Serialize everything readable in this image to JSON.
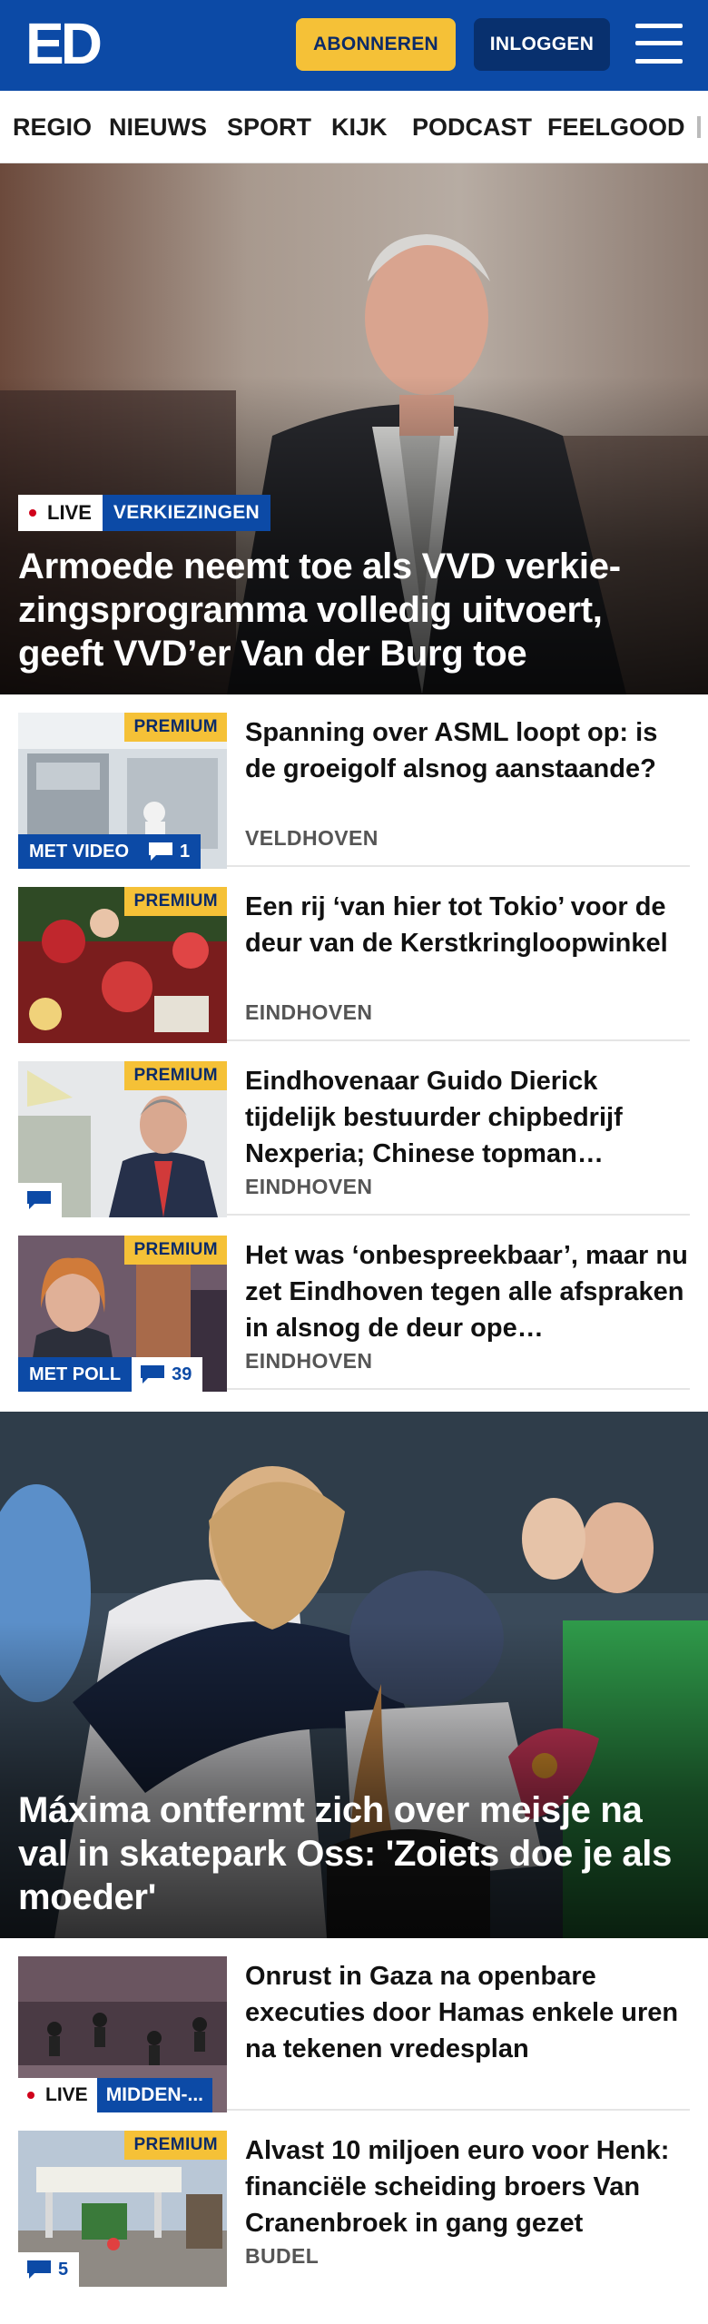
{
  "header": {
    "logo": "ED",
    "subscribe_label": "ABONNEREN",
    "login_label": "INLOGGEN",
    "brand_color": "#0c4aa6",
    "accent_color": "#f5c137"
  },
  "nav": {
    "items": [
      "REGIO",
      "NIEUWS",
      "SPORT",
      "KIJK",
      "PODCAST",
      "FEELGOOD"
    ]
  },
  "hero1": {
    "live_label": "LIVE",
    "tag": "VERKIEZINGEN",
    "title": "Armoede neemt toe als VVD verkie­zingsprogramma volledig uitvoert, geeft VVD’er Van der Burg toe"
  },
  "articles1": [
    {
      "premium": "PREMIUM",
      "media_tag": "MET VIDEO",
      "comments": "1",
      "headline": "Spanning over ASML loopt op: is de groeigolf alsnog aanstaande?",
      "location": "VELDHOVEN"
    },
    {
      "premium": "PREMIUM",
      "headline": "Een rij ‘van hier tot Tokio’ voor de deur van de Kerstkringloopwin­kel",
      "location": "EINDHOVEN"
    },
    {
      "premium": "PREMIUM",
      "comments": "",
      "headline": "Eindhovenaar Guido Dierick tijdelijk bestuurder chipbedrijf Nexperia; Chinese topman…",
      "location": "EINDHOVEN"
    },
    {
      "premium": "PREMIUM",
      "media_tag": "MET POLL",
      "comments": "39",
      "headline": "Het was ‘onbespreekbaar’, maar nu zet Eindhoven tegen alle afspraken in alsnog de deur ope…",
      "location": "EINDHOVEN"
    }
  ],
  "hero2": {
    "title": "Máxima ontfermt zich over meisje na val in skatepark Oss: 'Zoiets doe je als moeder'"
  },
  "articles2": [
    {
      "live_label": "LIVE",
      "tag": "MIDDEN-...",
      "headline": "Onrust in Gaza na openbare executies door Hamas enkele uren na tekenen vredesplan"
    },
    {
      "premium": "PREMIUM",
      "comments": "5",
      "headline": "Alvast 10 miljoen euro voor Henk: financiële scheiding broers Van Cranenbroek in gang gezet",
      "location": "BUDEL"
    }
  ]
}
